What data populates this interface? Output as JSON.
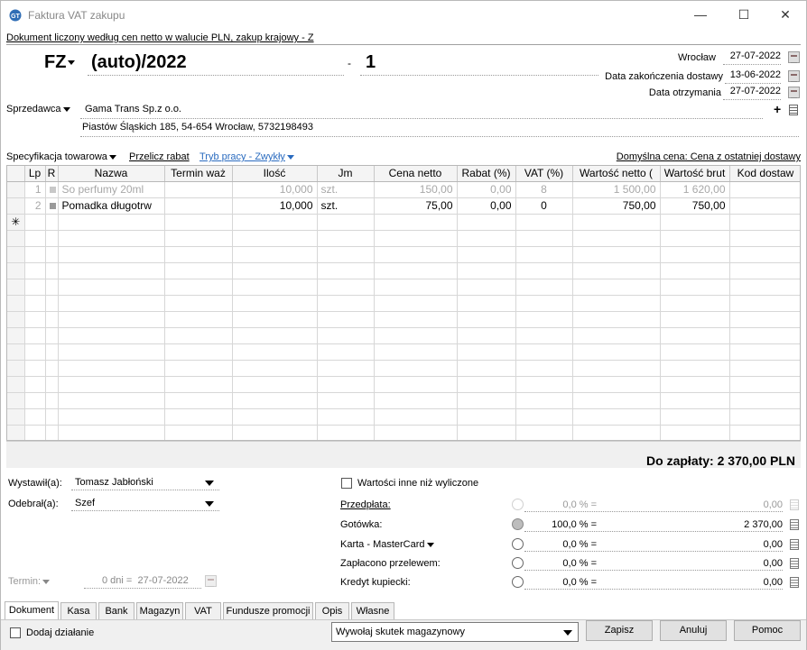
{
  "window": {
    "title": "Faktura VAT zakupu"
  },
  "doc_info": "Dokument liczony według cen netto w walucie PLN, zakup krajowy - Z",
  "header": {
    "series": "FZ",
    "number": "(auto)/2022",
    "dash": "-",
    "suffix": "1",
    "place": "Wrocław",
    "place_date": "27-07-2022",
    "delivery_label": "Data zakończenia dostawy",
    "delivery_date": "13-06-2022",
    "received_label": "Data otrzymania",
    "received_date": "27-07-2022"
  },
  "seller": {
    "label": "Sprzedawca",
    "name": "Gama Trans Sp.z o.o.",
    "address": "Piastów Śląskich 185, 54-654 Wrocław, 5732198493"
  },
  "links": {
    "spec": "Specyfikacja towarowa",
    "recalc": "Przelicz rabat",
    "mode": "Tryb pracy - Zwykły",
    "default_price": "Domyślna cena: Cena z ostatniej dostawy"
  },
  "table": {
    "columns": [
      "Lp",
      "R",
      "Nazwa",
      "Termin waż",
      "Ilość",
      "Jm",
      "Cena netto",
      "Rabat (%)",
      "VAT (%)",
      "Wartość netto (",
      "Wartość brut",
      "Kod dostaw"
    ],
    "rows": [
      {
        "lp": "1",
        "name": "So perfumy 20ml",
        "termin": "",
        "qty": "10,000",
        "unit": "szt.",
        "price": "150,00",
        "discount": "0,00",
        "vat": "8",
        "net": "1 500,00",
        "gross": "1 620,00",
        "code": ""
      },
      {
        "lp": "2",
        "name": "Pomadka długotrw",
        "termin": "",
        "qty": "10,000",
        "unit": "szt.",
        "price": "75,00",
        "discount": "0,00",
        "vat": "0",
        "net": "750,00",
        "gross": "750,00",
        "code": ""
      }
    ],
    "new_row_marker": "✳"
  },
  "total": "Do zapłaty: 2 370,00 PLN",
  "lower": {
    "issued_label": "Wystawił(a):",
    "issued_value": "Tomasz Jabłoński",
    "received_label": "Odebrał(a):",
    "received_value": "Szef",
    "term_label": "Termin:",
    "term_days": "0 dni =",
    "term_date": "27-07-2022",
    "other_values": "Wartości inne niż wyliczone",
    "payments": [
      {
        "label": "Przedpłata:",
        "pct": "0,0 % =",
        "value": "0,00"
      },
      {
        "label": "Gotówka:",
        "pct": "100,0 % =",
        "value": "2 370,00"
      },
      {
        "label": "Karta - MasterCard",
        "pct": "0,0 % =",
        "value": "0,00"
      },
      {
        "label": "Zapłacono przelewem:",
        "pct": "0,0 % =",
        "value": "0,00"
      },
      {
        "label": "Kredyt kupiecki:",
        "pct": "0,0 % =",
        "value": "0,00"
      }
    ]
  },
  "tabs": [
    "Dokument",
    "Kasa",
    "Bank",
    "Magazyn",
    "VAT",
    "Fundusze promocji",
    "Opis",
    "Własne"
  ],
  "bottom": {
    "add_action": "Dodaj działanie",
    "warehouse_select": "Wywołaj skutek magazynowy",
    "save": "Zapisz",
    "cancel": "Anuluj",
    "help": "Pomoc"
  }
}
